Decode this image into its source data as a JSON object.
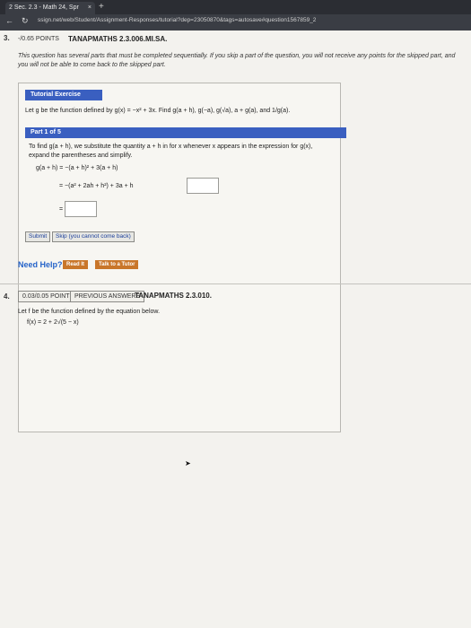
{
  "browser": {
    "tab_title": "2 Sec. 2.3 - Math 24, Spr",
    "tab_close": "×",
    "new_tab": "+",
    "url": "ssign.net/web/Student/Assignment-Responses/tutorial?dep=23050870&tags=autosave#question1567859_2"
  },
  "q3": {
    "number": "3.",
    "points": "-/0.65 POINTS",
    "code": "TANAPMATHS 2.3.006.MI.SA.",
    "intro": "This question has several parts that must be completed sequentially. If you skip a part of the question, you will not receive any points for the skipped part, and you will not be able to come back to the skipped part.",
    "tutorial_label": "Tutorial Exercise",
    "problem": "Let g be the function defined by g(x) = −x² + 3x. Find g(a + h), g(−a), g(√a), a + g(a), and 1/g(a).",
    "part_label": "Part 1 of 5",
    "step1": "To find g(a + h), we substitute the quantity a + h in for x whenever x appears in the expression for g(x),",
    "step2": "expand the parentheses and simplify.",
    "eq1": "g(a + h) = −(a + h)² + 3(a + h)",
    "eq2": "= −(a² + 2ah + h²) + 3a + h",
    "eq3": "=",
    "submit": "Submit",
    "skip": "Skip (you cannot come back)",
    "need_help": "Need Help?",
    "read_it": "Read It",
    "talk_tutor": "Talk to a Tutor"
  },
  "q4": {
    "number": "4.",
    "points": "0.03/0.05 POINTS",
    "prev_answers": "PREVIOUS ANSWERS",
    "code": "TANAPMATHS 2.3.010.",
    "text": "Let f be the function defined by the equation below.",
    "formula": "f(x) = 2 + 2√(5 − x)"
  }
}
